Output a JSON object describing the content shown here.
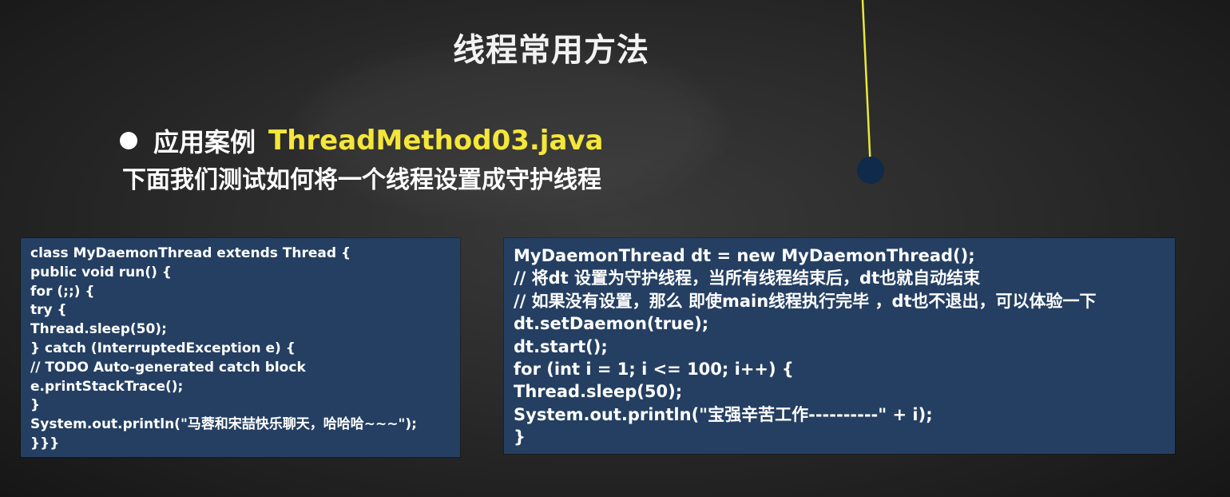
{
  "slide": {
    "title": "线程常用方法",
    "bullet_label": "应用案例",
    "bullet_file": "ThreadMethod03.java",
    "subtitle": "下面我们测试如何将一个线程设置成守护线程"
  },
  "code_left": {
    "lines": [
      "class MyDaemonThread extends Thread {",
      "public void run() {",
      "for (;;) {",
      "try {",
      "Thread.sleep(50);",
      "} catch (InterruptedException e) {",
      "// TODO Auto-generated catch block",
      "e.printStackTrace();",
      "}",
      "System.out.println(\"马蓉和宋喆快乐聊天，哈哈哈~~~\");",
      "}}}"
    ]
  },
  "code_right": {
    "lines": [
      "MyDaemonThread dt = new MyDaemonThread();",
      "// 将dt 设置为守护线程，当所有线程结束后，dt也就自动结束",
      "// 如果没有设置，那么 即使main线程执行完毕 ，dt也不退出，可以体验一下",
      "dt.setDaemon(true);",
      "dt.start();",
      "for (int i = 1; i <= 100; i++) {",
      "Thread.sleep(50);",
      "System.out.println(\"宝强辛苦工作----------\" + i);",
      "}"
    ]
  },
  "colors": {
    "background": "#2b2b2b",
    "code_box": "#243f62",
    "accent_yellow": "#f5e63a",
    "pointer_dot": "#0f2a4a"
  }
}
